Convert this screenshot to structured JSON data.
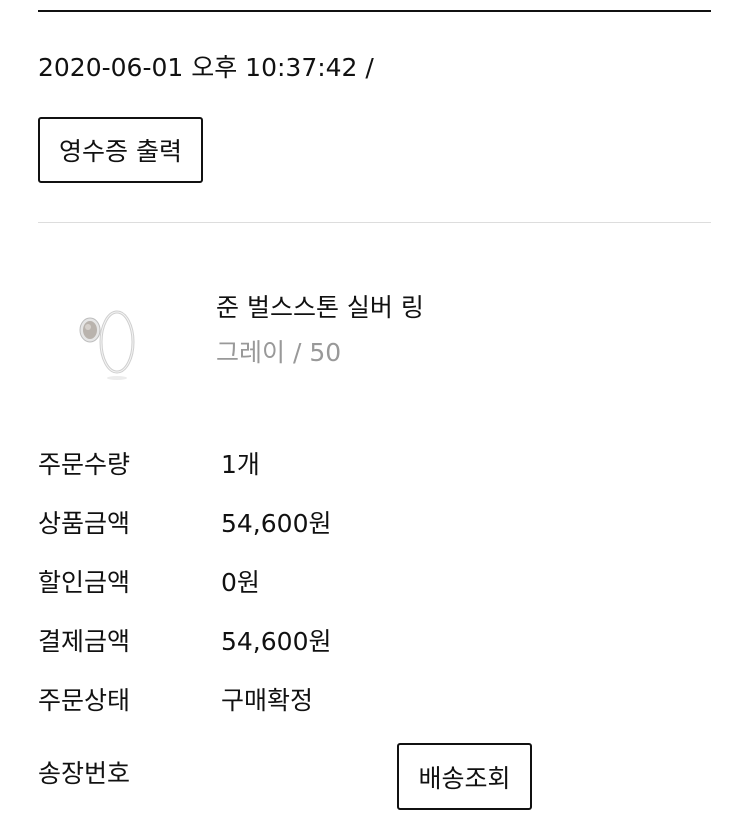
{
  "order": {
    "datetime": "2020-06-01 오후 10:37:42 /",
    "receipt_button": "영수증 출력"
  },
  "product": {
    "name": "준 벌스스톤 실버 링",
    "option": "그레이 / 50"
  },
  "details": [
    {
      "label": "주문수량",
      "value": "1개"
    },
    {
      "label": "상품금액",
      "value": "54,600원"
    },
    {
      "label": "할인금액",
      "value": "0원"
    },
    {
      "label": "결제금액",
      "value": "54,600원"
    },
    {
      "label": "주문상태",
      "value": "구매확정"
    },
    {
      "label": "송장번호",
      "value": ""
    }
  ],
  "tracking_button": "배송조회"
}
